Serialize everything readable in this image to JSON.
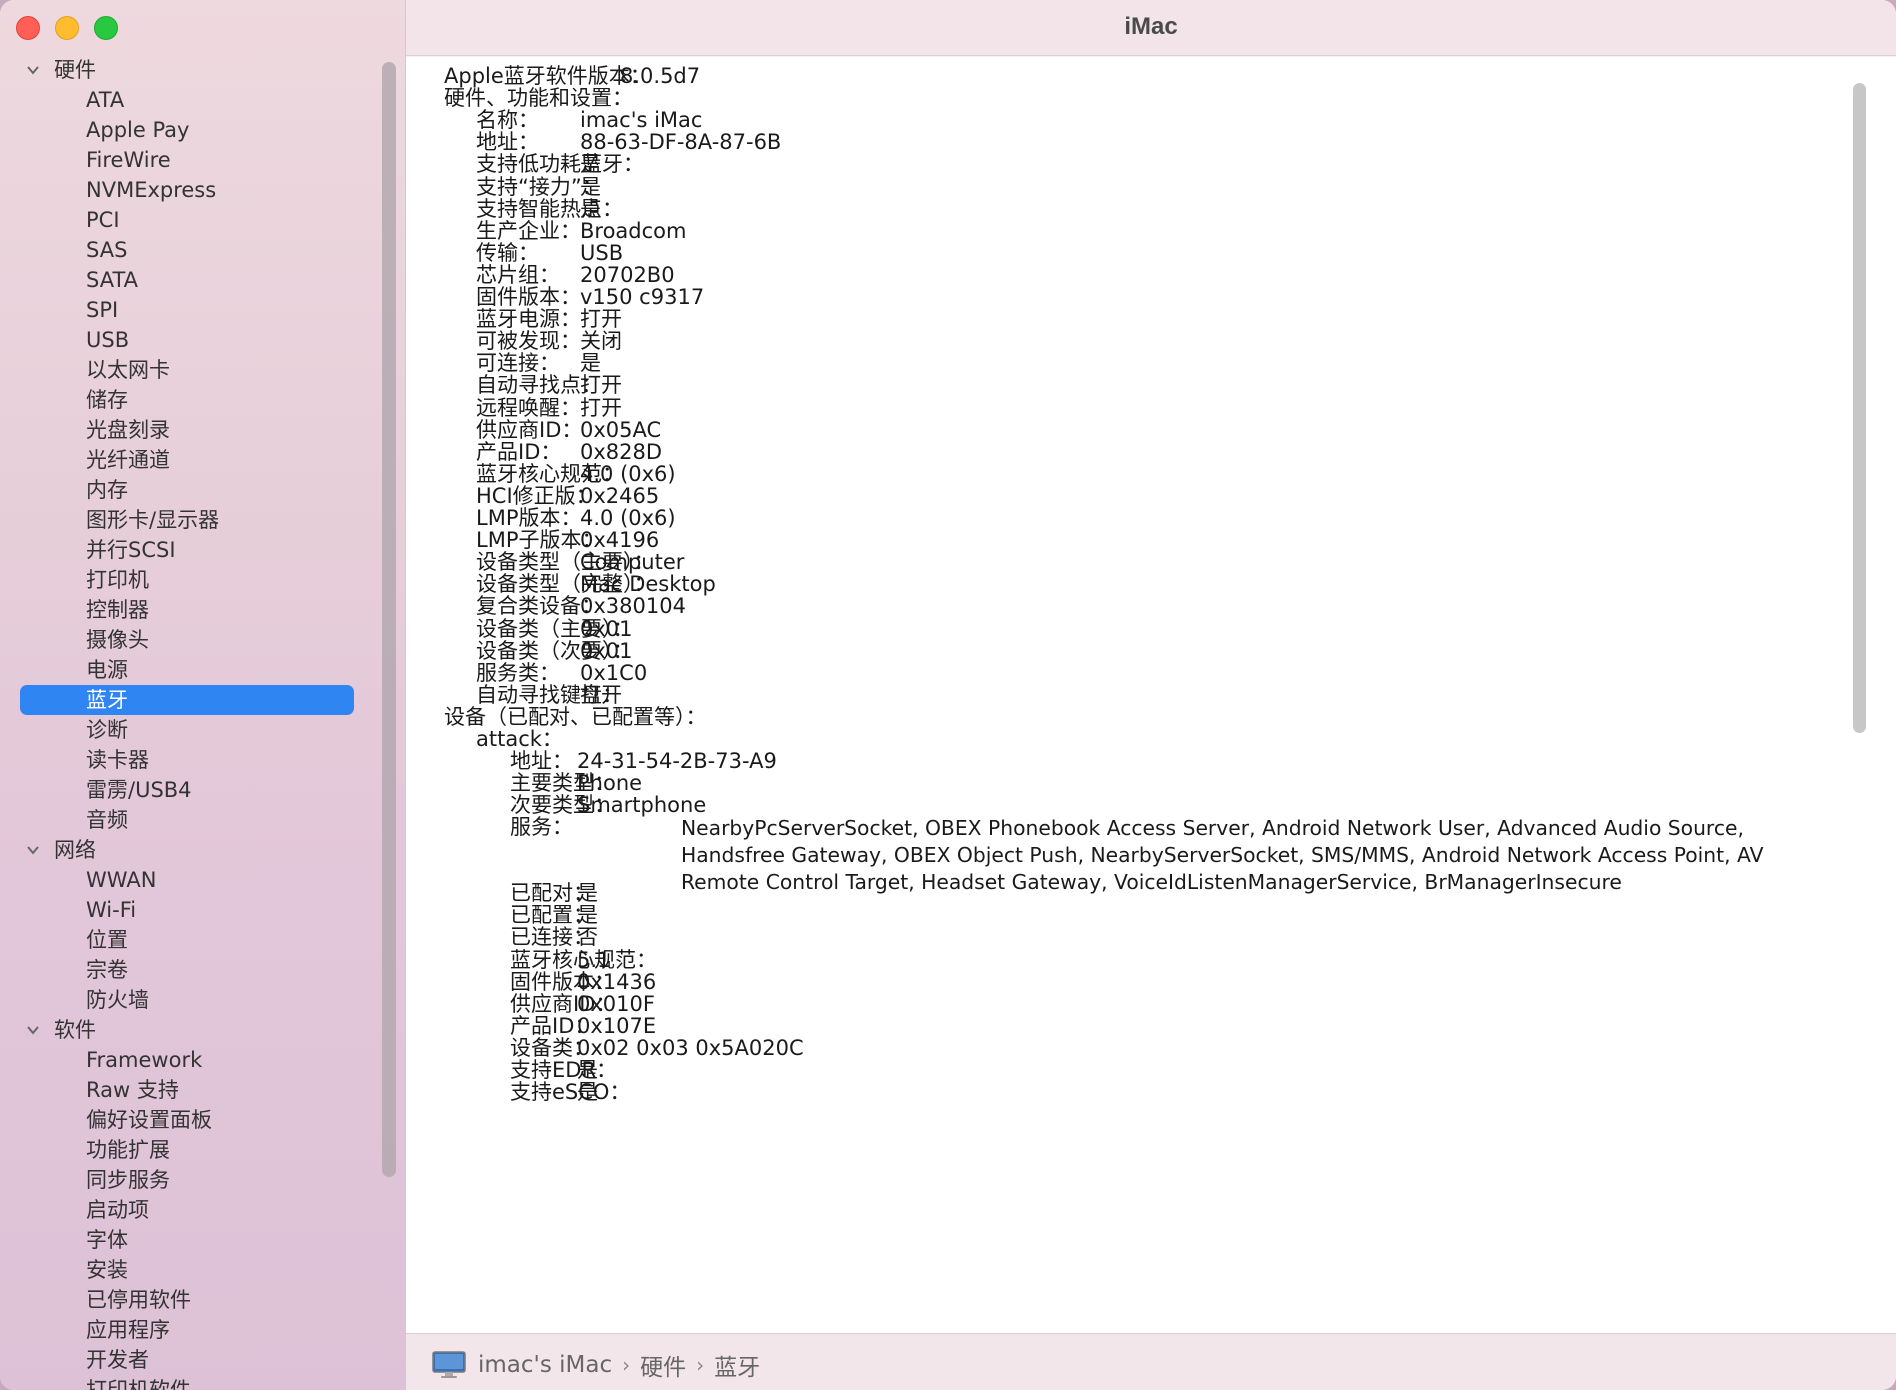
{
  "window": {
    "title": "iMac"
  },
  "sidebar": {
    "selected": "蓝牙",
    "groups": [
      {
        "label": "硬件",
        "items": [
          "ATA",
          "Apple Pay",
          "FireWire",
          "NVMExpress",
          "PCI",
          "SAS",
          "SATA",
          "SPI",
          "USB",
          "以太网卡",
          "储存",
          "光盘刻录",
          "光纤通道",
          "内存",
          "图形卡/显示器",
          "并行SCSI",
          "打印机",
          "控制器",
          "摄像头",
          "电源",
          "蓝牙",
          "诊断",
          "读卡器",
          "雷雳/USB4",
          "音频"
        ]
      },
      {
        "label": "网络",
        "items": [
          "WWAN",
          "Wi-Fi",
          "位置",
          "宗卷",
          "防火墙"
        ]
      },
      {
        "label": "软件",
        "items": [
          "Framework",
          "Raw 支持",
          "偏好设置面板",
          "功能扩展",
          "同步服务",
          "启动项",
          "字体",
          "安装",
          "已停用软件",
          "应用程序",
          "开发者",
          "打印机软件"
        ]
      }
    ]
  },
  "details": {
    "software_version": {
      "key": "Apple蓝牙软件版本：",
      "value": "8.0.5d7"
    },
    "hw_section": "硬件、功能和设置：",
    "hw_props": [
      {
        "key": "名称：",
        "value": "imac's iMac"
      },
      {
        "key": "地址：",
        "value": "88-63-DF-8A-87-6B"
      },
      {
        "key": "支持低功耗蓝牙：",
        "value": "是"
      },
      {
        "key": "支持“接力”：",
        "value": "是"
      },
      {
        "key": "支持智能热点：",
        "value": "是"
      },
      {
        "key": "生产企业：",
        "value": "Broadcom"
      },
      {
        "key": "传输：",
        "value": "USB"
      },
      {
        "key": "芯片组：",
        "value": "20702B0"
      },
      {
        "key": "固件版本：",
        "value": "v150 c9317"
      },
      {
        "key": "蓝牙电源：",
        "value": "打开"
      },
      {
        "key": "可被发现：",
        "value": "关闭"
      },
      {
        "key": "可连接：",
        "value": "是"
      },
      {
        "key": "自动寻找点：",
        "value": "打开"
      },
      {
        "key": "远程唤醒：",
        "value": "打开"
      },
      {
        "key": "供应商ID：",
        "value": "0x05AC"
      },
      {
        "key": "产品ID：",
        "value": "0x828D"
      },
      {
        "key": "蓝牙核心规范：",
        "value": "4.0 (0x6)"
      },
      {
        "key": "HCI修正版：",
        "value": "0x2465"
      },
      {
        "key": "LMP版本：",
        "value": "4.0 (0x6)"
      },
      {
        "key": "LMP子版本：",
        "value": "0x4196"
      },
      {
        "key": "设备类型（主要）：",
        "value": "Computer"
      },
      {
        "key": "设备类型（完整）：",
        "value": "Mac Desktop"
      },
      {
        "key": "复合类设备：",
        "value": "0x380104"
      },
      {
        "key": "设备类（主要）：",
        "value": "0x01"
      },
      {
        "key": "设备类（次要）：",
        "value": "0x01"
      },
      {
        "key": "服务类：",
        "value": "0x1C0"
      },
      {
        "key": "自动寻找键盘：",
        "value": "打开"
      }
    ],
    "devices_section": "设备（已配对、已配置等）：",
    "device_name": "attack：",
    "device_props_a": [
      {
        "key": "地址：",
        "value": "24-31-54-2B-73-A9"
      },
      {
        "key": "主要类型：",
        "value": "Phone"
      },
      {
        "key": "次要类型：",
        "value": "Smartphone"
      }
    ],
    "services": {
      "key": "服务：",
      "value": "NearbyPcServerSocket, OBEX Phonebook Access Server, Android Network User, Advanced Audio Source, Handsfree Gateway, OBEX Object Push, NearbyServerSocket, SMS/MMS, Android Network Access Point, AV Remote Control Target, Headset Gateway, VoiceIdListenManagerService, BrManagerInsecure"
    },
    "device_props_b": [
      {
        "key": "已配对：",
        "value": "是"
      },
      {
        "key": "已配置：",
        "value": "是"
      },
      {
        "key": "已连接：",
        "value": "否"
      },
      {
        "key": "蓝牙核心规范：",
        "value": "5.1"
      },
      {
        "key": "固件版本：",
        "value": "0x1436"
      },
      {
        "key": "供应商ID：",
        "value": "0x010F"
      },
      {
        "key": "产品ID：",
        "value": "0x107E"
      },
      {
        "key": "设备类：",
        "value": "0x02 0x03 0x5A020C"
      },
      {
        "key": "支持EDR：",
        "value": "是"
      },
      {
        "key": "支持eSCO：",
        "value": "是"
      }
    ]
  },
  "statusbar": {
    "crumbs": [
      "imac's iMac",
      "硬件",
      "蓝牙"
    ],
    "separator": "›",
    "icon": "imac-icon"
  }
}
